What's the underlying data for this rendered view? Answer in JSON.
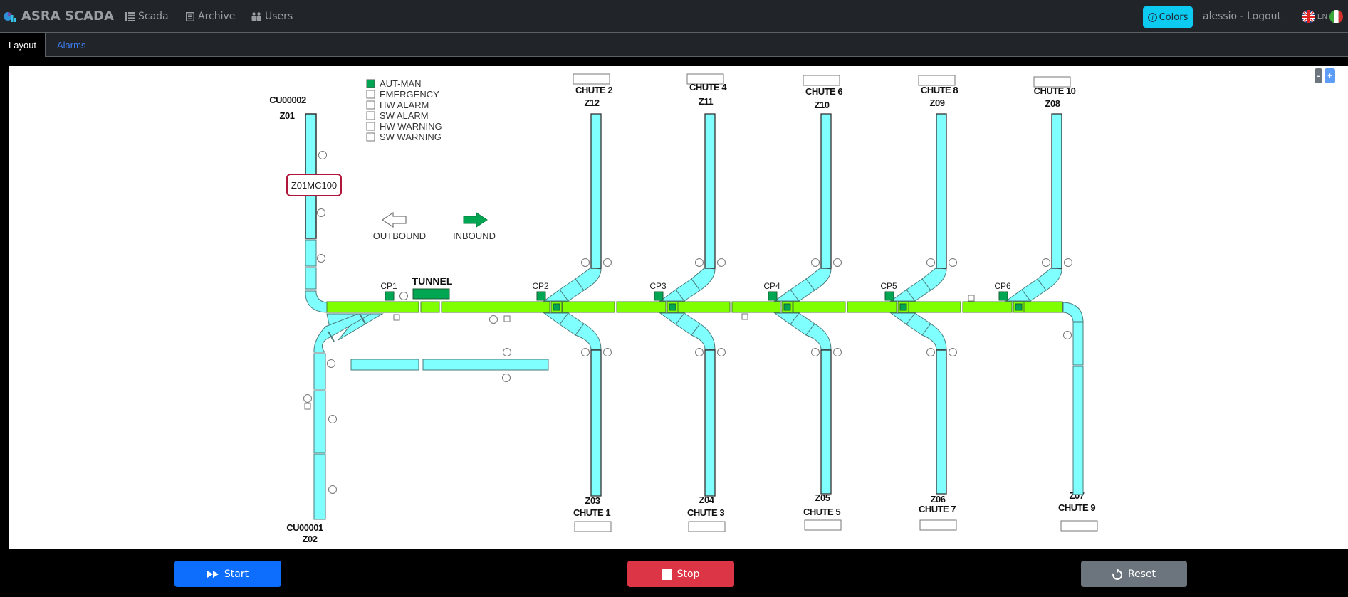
{
  "app": {
    "brand": "ASRA SCADA"
  },
  "nav": {
    "items": [
      {
        "label": "Scada",
        "icon": "list-icon"
      },
      {
        "label": "Archive",
        "icon": "book-icon"
      },
      {
        "label": "Users",
        "icon": "users-icon"
      }
    ],
    "colors_label": "Colors",
    "user_label": "alessio - Logout",
    "lang_label": "EN"
  },
  "tabs": [
    {
      "label": "Layout",
      "active": true
    },
    {
      "label": "Alarms",
      "active": false
    }
  ],
  "zoom": {
    "minus": "-",
    "plus": "+"
  },
  "legend": {
    "items": [
      {
        "label": "AUT-MAN",
        "active": true
      },
      {
        "label": "EMERGENCY",
        "active": false
      },
      {
        "label": "HW ALARM",
        "active": false
      },
      {
        "label": "SW ALARM",
        "active": false
      },
      {
        "label": "HW WARNING",
        "active": false
      },
      {
        "label": "SW WARNING",
        "active": false
      }
    ]
  },
  "directions": {
    "outbound": "OUTBOUND",
    "inbound": "INBOUND"
  },
  "layout": {
    "cu_top": "CU00002",
    "zone_top": "Z01",
    "machine_tag": "Z01MC100",
    "cu_bottom": "CU00001",
    "zone_bottom": "Z02",
    "tunnel": "TUNNEL",
    "checkpoints": [
      "CP1",
      "CP2",
      "CP3",
      "CP4",
      "CP5",
      "CP6"
    ],
    "top_chutes": [
      {
        "chute": "CHUTE 2",
        "zone": "Z12"
      },
      {
        "chute": "CHUTE 4",
        "zone": "Z11"
      },
      {
        "chute": "CHUTE 6",
        "zone": "Z10"
      },
      {
        "chute": "CHUTE 8",
        "zone": "Z09"
      },
      {
        "chute": "CHUTE 10",
        "zone": "Z08"
      }
    ],
    "bottom_chutes": [
      {
        "chute": "CHUTE 1",
        "zone": "Z03"
      },
      {
        "chute": "CHUTE 3",
        "zone": "Z04"
      },
      {
        "chute": "CHUTE 5",
        "zone": "Z05"
      },
      {
        "chute": "CHUTE 7",
        "zone": "Z06"
      },
      {
        "chute": "CHUTE 9",
        "zone": "Z07"
      }
    ]
  },
  "colors": {
    "conveyor": "#7fff00",
    "chute": "#80ffff",
    "status_ok": "#00a651",
    "tag_border": "#b0163a"
  },
  "controls": {
    "start": "Start",
    "stop": "Stop",
    "reset": "Reset"
  }
}
